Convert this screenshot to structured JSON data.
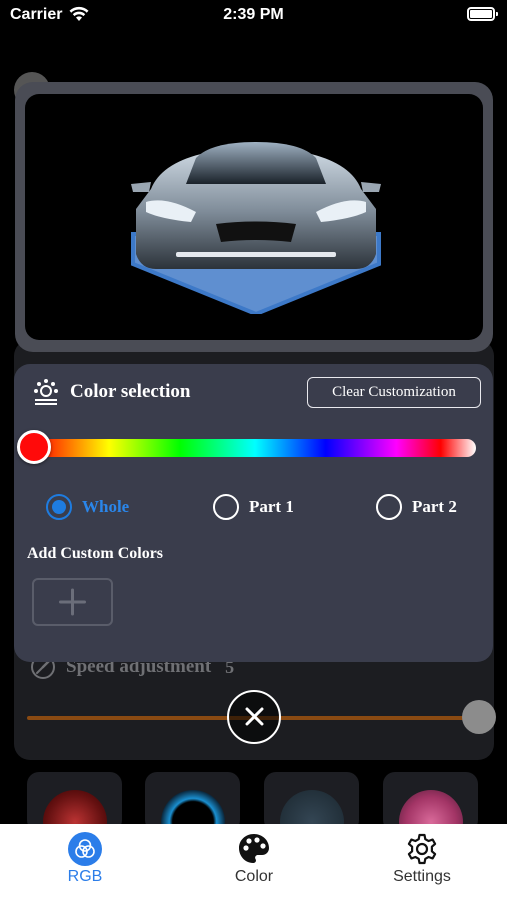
{
  "status_bar": {
    "carrier": "Carrier",
    "time": "2:39 PM"
  },
  "color_panel": {
    "title": "Color selection",
    "clear_button": "Clear Customization",
    "parts": [
      {
        "label": "Whole",
        "selected": true
      },
      {
        "label": "Part 1",
        "selected": false
      },
      {
        "label": "Part 2",
        "selected": false
      }
    ],
    "custom_colors_label": "Add Custom Colors",
    "selected_color": "#ff0a0a"
  },
  "speed": {
    "label": "Speed adjustment",
    "value": "5"
  },
  "tab_bar": {
    "tabs": [
      {
        "label": "RGB",
        "icon": "rgb-icon",
        "active": true
      },
      {
        "label": "Color",
        "icon": "palette-icon",
        "active": false
      },
      {
        "label": "Settings",
        "icon": "gear-icon",
        "active": false
      }
    ]
  },
  "colors": {
    "accent": "#1e7ce0",
    "panel": "#3a3d4c",
    "speed_track": "#8a4a12"
  }
}
